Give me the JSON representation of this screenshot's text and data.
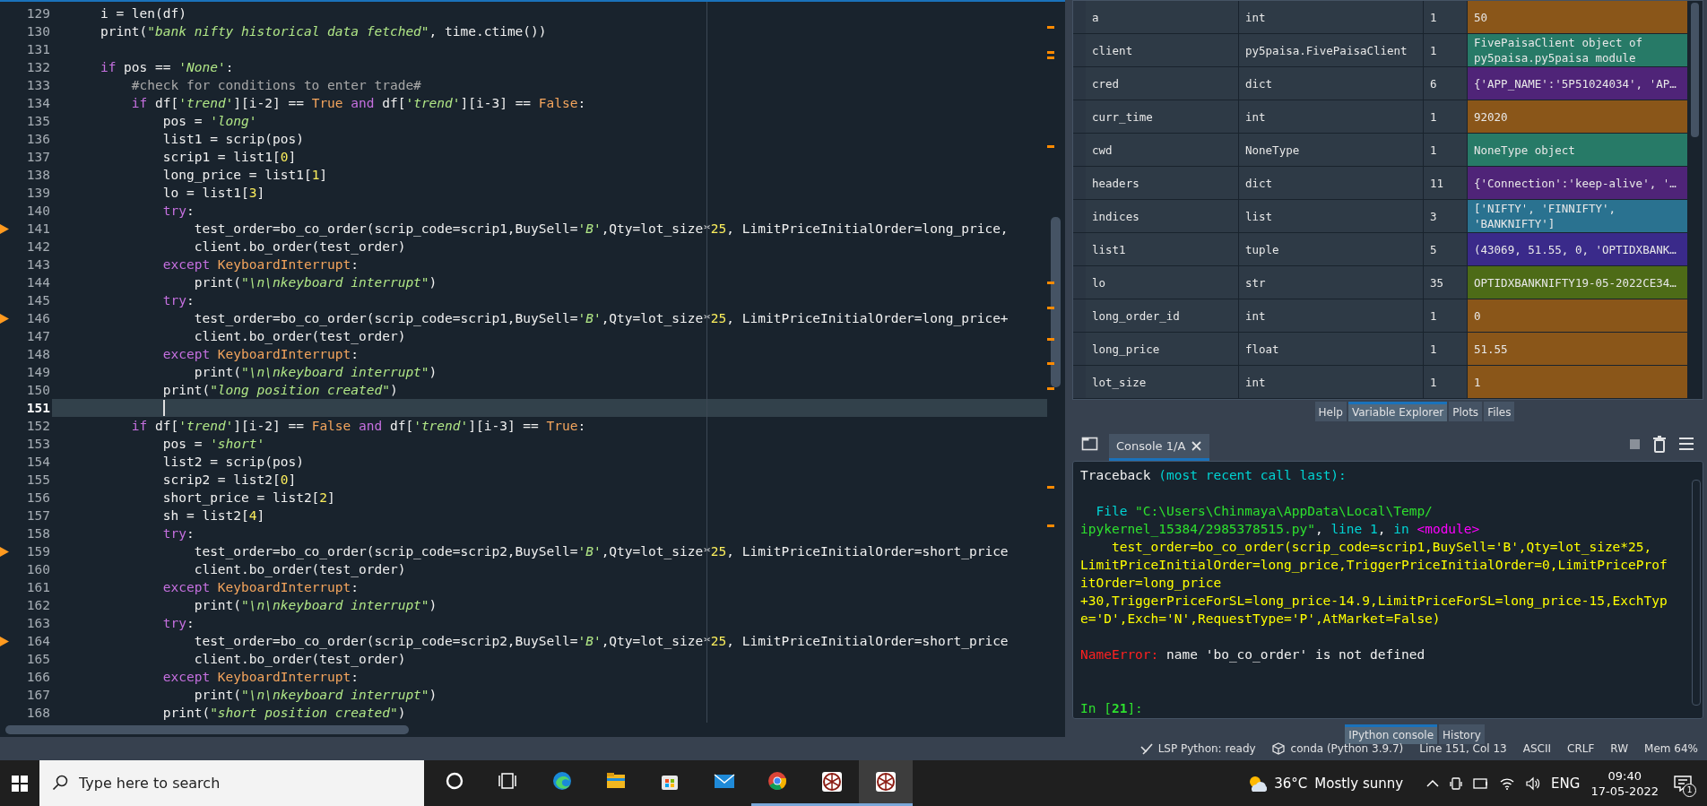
{
  "editor": {
    "lines": [
      {
        "number": "129",
        "warning": false,
        "current": false,
        "tokens": [
          {
            "kind": "plain",
            "text": "    i = len(df)"
          }
        ]
      },
      {
        "number": "130",
        "warning": false,
        "current": false,
        "tokens": [
          {
            "kind": "plain",
            "text": "    print("
          },
          {
            "kind": "string",
            "text": "\"bank nifty historical data fetched\""
          },
          {
            "kind": "plain",
            "text": ", time.ctime())"
          }
        ]
      },
      {
        "number": "131",
        "warning": false,
        "current": false
      },
      {
        "number": "132",
        "warning": false,
        "current": false,
        "tokens": [
          {
            "kind": "keyword",
            "text": "    if"
          },
          {
            "kind": "plain",
            "text": " pos == "
          },
          {
            "kind": "string",
            "text": "'None'"
          },
          {
            "kind": "plain",
            "text": ":"
          }
        ]
      },
      {
        "number": "133",
        "warning": false,
        "current": false,
        "tokens": [
          {
            "kind": "comment",
            "text": "        #check for conditions to enter trade#"
          }
        ]
      },
      {
        "number": "134",
        "warning": false,
        "current": false,
        "tokens": [
          {
            "kind": "keyword",
            "text": "        if"
          },
          {
            "kind": "plain",
            "text": " df["
          },
          {
            "kind": "string",
            "text": "'trend'"
          },
          {
            "kind": "plain",
            "text": "][i-2] == "
          },
          {
            "kind": "constant",
            "text": "True"
          },
          {
            "kind": "keyword",
            "text": " and"
          },
          {
            "kind": "plain",
            "text": " df["
          },
          {
            "kind": "string",
            "text": "'trend'"
          },
          {
            "kind": "plain",
            "text": "][i-3] == "
          },
          {
            "kind": "constant",
            "text": "False"
          },
          {
            "kind": "plain",
            "text": ":"
          }
        ]
      },
      {
        "number": "135",
        "warning": false,
        "current": false,
        "tokens": [
          {
            "kind": "plain",
            "text": "            pos = "
          },
          {
            "kind": "string",
            "text": "'long'"
          }
        ]
      },
      {
        "number": "136",
        "warning": false,
        "current": false,
        "tokens": [
          {
            "kind": "plain",
            "text": "            list1 = scrip(pos)"
          }
        ]
      },
      {
        "number": "137",
        "warning": false,
        "current": false,
        "tokens": [
          {
            "kind": "plain",
            "text": "            scrip1 = list1["
          },
          {
            "kind": "number",
            "text": "0"
          },
          {
            "kind": "plain",
            "text": "]"
          }
        ]
      },
      {
        "number": "138",
        "warning": false,
        "current": false,
        "tokens": [
          {
            "kind": "plain",
            "text": "            long_price = list1["
          },
          {
            "kind": "number",
            "text": "1"
          },
          {
            "kind": "plain",
            "text": "]"
          }
        ]
      },
      {
        "number": "139",
        "warning": false,
        "current": false,
        "tokens": [
          {
            "kind": "plain",
            "text": "            lo = list1["
          },
          {
            "kind": "number",
            "text": "3"
          },
          {
            "kind": "plain",
            "text": "]"
          }
        ]
      },
      {
        "number": "140",
        "warning": false,
        "current": false,
        "tokens": [
          {
            "kind": "keyword",
            "text": "            try"
          },
          {
            "kind": "plain",
            "text": ":"
          }
        ]
      },
      {
        "number": "141",
        "warning": true,
        "current": false,
        "tokens": [
          {
            "kind": "plain",
            "text": "                test_order=bo_co_order(scrip_code=scrip1,BuySell="
          },
          {
            "kind": "string",
            "text": "'B'"
          },
          {
            "kind": "plain",
            "text": ",Qty=lot_size*"
          },
          {
            "kind": "number",
            "text": "25"
          },
          {
            "kind": "plain",
            "text": ", LimitPriceInitialOrder=long_price,"
          }
        ]
      },
      {
        "number": "142",
        "warning": false,
        "current": false,
        "tokens": [
          {
            "kind": "plain",
            "text": "                client.bo_order(test_order)"
          }
        ]
      },
      {
        "number": "143",
        "warning": false,
        "current": false,
        "tokens": [
          {
            "kind": "keyword",
            "text": "            except"
          },
          {
            "kind": "constant",
            "text": " KeyboardInterrupt"
          },
          {
            "kind": "plain",
            "text": ":"
          }
        ]
      },
      {
        "number": "144",
        "warning": false,
        "current": false,
        "tokens": [
          {
            "kind": "plain",
            "text": "                print("
          },
          {
            "kind": "string",
            "text": "\"\\n\\nkeyboard interrupt\""
          },
          {
            "kind": "plain",
            "text": ")"
          }
        ]
      },
      {
        "number": "145",
        "warning": false,
        "current": false,
        "tokens": [
          {
            "kind": "keyword",
            "text": "            try"
          },
          {
            "kind": "plain",
            "text": ":"
          }
        ]
      },
      {
        "number": "146",
        "warning": true,
        "current": false,
        "tokens": [
          {
            "kind": "plain",
            "text": "                test_order=bo_co_order(scrip_code=scrip1,BuySell="
          },
          {
            "kind": "string",
            "text": "'B'"
          },
          {
            "kind": "plain",
            "text": ",Qty=lot_size*"
          },
          {
            "kind": "number",
            "text": "25"
          },
          {
            "kind": "plain",
            "text": ", LimitPriceInitialOrder=long_price+"
          }
        ]
      },
      {
        "number": "147",
        "warning": false,
        "current": false,
        "tokens": [
          {
            "kind": "plain",
            "text": "                client.bo_order(test_order)"
          }
        ]
      },
      {
        "number": "148",
        "warning": false,
        "current": false,
        "tokens": [
          {
            "kind": "keyword",
            "text": "            except"
          },
          {
            "kind": "constant",
            "text": " KeyboardInterrupt"
          },
          {
            "kind": "plain",
            "text": ":"
          }
        ]
      },
      {
        "number": "149",
        "warning": false,
        "current": false,
        "tokens": [
          {
            "kind": "plain",
            "text": "                print("
          },
          {
            "kind": "string",
            "text": "\"\\n\\nkeyboard interrupt\""
          },
          {
            "kind": "plain",
            "text": ")"
          }
        ]
      },
      {
        "number": "150",
        "warning": false,
        "current": false,
        "tokens": [
          {
            "kind": "plain",
            "text": "            print("
          },
          {
            "kind": "string",
            "text": "\"long position created\""
          },
          {
            "kind": "plain",
            "text": ")"
          }
        ]
      },
      {
        "number": "151",
        "warning": false,
        "current": true
      },
      {
        "number": "152",
        "warning": false,
        "current": false,
        "tokens": [
          {
            "kind": "keyword",
            "text": "        if"
          },
          {
            "kind": "plain",
            "text": " df["
          },
          {
            "kind": "string",
            "text": "'trend'"
          },
          {
            "kind": "plain",
            "text": "][i-2] == "
          },
          {
            "kind": "constant",
            "text": "False"
          },
          {
            "kind": "keyword",
            "text": " and"
          },
          {
            "kind": "plain",
            "text": " df["
          },
          {
            "kind": "string",
            "text": "'trend'"
          },
          {
            "kind": "plain",
            "text": "][i-3] == "
          },
          {
            "kind": "constant",
            "text": "True"
          },
          {
            "kind": "plain",
            "text": ":"
          }
        ]
      },
      {
        "number": "153",
        "warning": false,
        "current": false,
        "tokens": [
          {
            "kind": "plain",
            "text": "            pos = "
          },
          {
            "kind": "string",
            "text": "'short'"
          }
        ]
      },
      {
        "number": "154",
        "warning": false,
        "current": false,
        "tokens": [
          {
            "kind": "plain",
            "text": "            list2 = scrip(pos)"
          }
        ]
      },
      {
        "number": "155",
        "warning": false,
        "current": false,
        "tokens": [
          {
            "kind": "plain",
            "text": "            scrip2 = list2["
          },
          {
            "kind": "number",
            "text": "0"
          },
          {
            "kind": "plain",
            "text": "]"
          }
        ]
      },
      {
        "number": "156",
        "warning": false,
        "current": false,
        "tokens": [
          {
            "kind": "plain",
            "text": "            short_price = list2["
          },
          {
            "kind": "number",
            "text": "2"
          },
          {
            "kind": "plain",
            "text": "]"
          }
        ]
      },
      {
        "number": "157",
        "warning": false,
        "current": false,
        "tokens": [
          {
            "kind": "plain",
            "text": "            sh = list2["
          },
          {
            "kind": "number",
            "text": "4"
          },
          {
            "kind": "plain",
            "text": "]"
          }
        ]
      },
      {
        "number": "158",
        "warning": false,
        "current": false,
        "tokens": [
          {
            "kind": "keyword",
            "text": "            try"
          },
          {
            "kind": "plain",
            "text": ":"
          }
        ]
      },
      {
        "number": "159",
        "warning": true,
        "current": false,
        "tokens": [
          {
            "kind": "plain",
            "text": "                test_order=bo_co_order(scrip_code=scrip2,BuySell="
          },
          {
            "kind": "string",
            "text": "'B'"
          },
          {
            "kind": "plain",
            "text": ",Qty=lot_size*"
          },
          {
            "kind": "number",
            "text": "25"
          },
          {
            "kind": "plain",
            "text": ", LimitPriceInitialOrder=short_price"
          }
        ]
      },
      {
        "number": "160",
        "warning": false,
        "current": false,
        "tokens": [
          {
            "kind": "plain",
            "text": "                client.bo_order(test_order)"
          }
        ]
      },
      {
        "number": "161",
        "warning": false,
        "current": false,
        "tokens": [
          {
            "kind": "keyword",
            "text": "            except"
          },
          {
            "kind": "constant",
            "text": " KeyboardInterrupt"
          },
          {
            "kind": "plain",
            "text": ":"
          }
        ]
      },
      {
        "number": "162",
        "warning": false,
        "current": false,
        "tokens": [
          {
            "kind": "plain",
            "text": "                print("
          },
          {
            "kind": "string",
            "text": "\"\\n\\nkeyboard interrupt\""
          },
          {
            "kind": "plain",
            "text": ")"
          }
        ]
      },
      {
        "number": "163",
        "warning": false,
        "current": false,
        "tokens": [
          {
            "kind": "keyword",
            "text": "            try"
          },
          {
            "kind": "plain",
            "text": ":"
          }
        ]
      },
      {
        "number": "164",
        "warning": true,
        "current": false,
        "tokens": [
          {
            "kind": "plain",
            "text": "                test_order=bo_co_order(scrip_code=scrip2,BuySell="
          },
          {
            "kind": "string",
            "text": "'B'"
          },
          {
            "kind": "plain",
            "text": ",Qty=lot_size*"
          },
          {
            "kind": "number",
            "text": "25"
          },
          {
            "kind": "plain",
            "text": ", LimitPriceInitialOrder=short_price"
          }
        ]
      },
      {
        "number": "165",
        "warning": false,
        "current": false,
        "tokens": [
          {
            "kind": "plain",
            "text": "                client.bo_order(test_order)"
          }
        ]
      },
      {
        "number": "166",
        "warning": false,
        "current": false,
        "tokens": [
          {
            "kind": "keyword",
            "text": "            except"
          },
          {
            "kind": "constant",
            "text": " KeyboardInterrupt"
          },
          {
            "kind": "plain",
            "text": ":"
          }
        ]
      },
      {
        "number": "167",
        "warning": false,
        "current": false,
        "tokens": [
          {
            "kind": "plain",
            "text": "                print("
          },
          {
            "kind": "string",
            "text": "\"\\n\\nkeyboard interrupt\""
          },
          {
            "kind": "plain",
            "text": ")"
          }
        ]
      },
      {
        "number": "168",
        "warning": false,
        "current": false,
        "tokens": [
          {
            "kind": "plain",
            "text": "            print("
          },
          {
            "kind": "string",
            "text": "\"short position created\""
          },
          {
            "kind": "plain",
            "text": ")"
          }
        ]
      }
    ]
  },
  "variable_explorer": {
    "rows": [
      {
        "name": "a",
        "type": "int",
        "size": "1",
        "value": "50",
        "color": "#8a5619"
      },
      {
        "name": "client",
        "type": "py5paisa.FivePaisaClient",
        "size": "1",
        "value": "FivePaisaClient object of py5paisa.py5paisa module",
        "color": "#277a67"
      },
      {
        "name": "cred",
        "type": "dict",
        "size": "6",
        "value": "{'APP_NAME':'5P51024034', 'AP…",
        "color": "#4f2478"
      },
      {
        "name": "curr_time",
        "type": "int",
        "size": "1",
        "value": "92020",
        "color": "#8a5619"
      },
      {
        "name": "cwd",
        "type": "NoneType",
        "size": "1",
        "value": "NoneType object",
        "color": "#277a67"
      },
      {
        "name": "headers",
        "type": "dict",
        "size": "11",
        "value": "{'Connection':'keep-alive', '…",
        "color": "#4f2478"
      },
      {
        "name": "indices",
        "type": "list",
        "size": "3",
        "value": "['NIFTY', 'FINNIFTY', 'BANKNIFTY']",
        "color": "#2a7290"
      },
      {
        "name": "list1",
        "type": "tuple",
        "size": "5",
        "value": "(43069, 51.55, 0, 'OPTIDXBANK…",
        "color": "#3a2a8a"
      },
      {
        "name": "lo",
        "type": "str",
        "size": "35",
        "value": "OPTIDXBANKNIFTY19-05-2022CE34…",
        "color": "#4d6b17"
      },
      {
        "name": "long_order_id",
        "type": "int",
        "size": "1",
        "value": "0",
        "color": "#8a5619"
      },
      {
        "name": "long_price",
        "type": "float",
        "size": "1",
        "value": "51.55",
        "color": "#8a5619"
      },
      {
        "name": "lot_size",
        "type": "int",
        "size": "1",
        "value": "1",
        "color": "#8a5619"
      }
    ]
  },
  "pane_tabs": [
    {
      "label": "Help",
      "selected": false
    },
    {
      "label": "Variable Explorer",
      "selected": true
    },
    {
      "label": "Plots",
      "selected": false
    },
    {
      "label": "Files",
      "selected": false
    }
  ],
  "console": {
    "tabs": [
      {
        "label": "Console 1/A",
        "selected": true
      }
    ],
    "blocks": [
      {
        "kind": "traceback",
        "lines": [
          {
            "segments": [
              {
                "kind": "plain",
                "text": "Traceback "
              },
              {
                "kind": "cyan",
                "text": "(most recent call last):"
              }
            ]
          }
        ]
      },
      {
        "kind": "frame",
        "lines": [
          {
            "segments": [
              {
                "kind": "cyan",
                "text": "  File "
              },
              {
                "kind": "green",
                "text": "\"C:\\Users\\Chinmaya\\AppData\\Local\\Temp/"
              }
            ]
          },
          {
            "segments": [
              {
                "kind": "green",
                "text": "ipykernel_15384/2985378515.py\""
              },
              {
                "kind": "plain",
                "text": ", "
              },
              {
                "kind": "cyan",
                "text": "line 1"
              },
              {
                "kind": "plain",
                "text": ", "
              },
              {
                "kind": "cyan",
                "text": "in "
              },
              {
                "kind": "magenta",
                "text": "<module>"
              }
            ]
          },
          {
            "segments": [
              {
                "kind": "yellow",
                "text": "    test_order=bo_co_order(scrip_code=scrip1,BuySell='B',Qty=lot_size*25,"
              }
            ]
          },
          {
            "segments": [
              {
                "kind": "yellow",
                "text": "LimitPriceInitialOrder=long_price,TriggerPriceInitialOrder=0,LimitPriceProf"
              }
            ]
          },
          {
            "segments": [
              {
                "kind": "yellow",
                "text": "itOrder=long_price"
              }
            ]
          },
          {
            "segments": [
              {
                "kind": "yellow",
                "text": "+30,TriggerPriceForSL=long_price-14.9,LimitPriceForSL=long_price-15,ExchTyp"
              }
            ]
          },
          {
            "segments": [
              {
                "kind": "yellow",
                "text": "e='D',Exch='N',RequestType='P',AtMarket=False)"
              }
            ]
          }
        ]
      },
      {
        "kind": "error",
        "lines": [
          {
            "segments": [
              {
                "kind": "red",
                "text": "NameError:"
              },
              {
                "kind": "plain",
                "text": " name 'bo_co_order' is not defined"
              }
            ]
          }
        ]
      },
      {
        "kind": "prompt",
        "lines": [
          {
            "segments": [
              {
                "kind": "green",
                "text": "In ["
              },
              {
                "kind": "prompt",
                "text": "21"
              },
              {
                "kind": "green",
                "text": "]:"
              }
            ]
          }
        ]
      }
    ]
  },
  "console_tabs": [
    {
      "label": "IPython console",
      "selected": true
    },
    {
      "label": "History",
      "selected": false
    }
  ],
  "status_bar": {
    "items": [
      {
        "kind": "lsp",
        "text": "LSP Python: ready"
      },
      {
        "kind": "conda",
        "text": "conda (Python 3.9.7)"
      },
      {
        "kind": "plain",
        "text": "Line 151, Col 13"
      },
      {
        "kind": "plain",
        "text": "ASCII"
      },
      {
        "kind": "plain",
        "text": "CRLF"
      },
      {
        "kind": "plain",
        "text": "RW"
      },
      {
        "kind": "plain",
        "text": "Mem 64%"
      }
    ]
  },
  "taskbar": {
    "search": {
      "placeholder": "Type here to search"
    },
    "apps": [
      {
        "kind": "cortana",
        "running": false,
        "active": false
      },
      {
        "kind": "taskview",
        "running": false,
        "active": false
      },
      {
        "kind": "edge",
        "running": false,
        "active": false
      },
      {
        "kind": "explorer",
        "running": false,
        "active": false
      },
      {
        "kind": "store",
        "running": false,
        "active": false
      },
      {
        "kind": "mail",
        "running": false,
        "active": false
      },
      {
        "kind": "chrome",
        "running": true,
        "active": false
      },
      {
        "kind": "spyder",
        "running": true,
        "active": false
      },
      {
        "kind": "spyder",
        "running": true,
        "active": true
      }
    ],
    "weather": {
      "temperature": "36°C",
      "condition": "Mostly sunny"
    },
    "language": "ENG",
    "time": "09:40",
    "date": "17-05-2022",
    "notifications": "1"
  }
}
